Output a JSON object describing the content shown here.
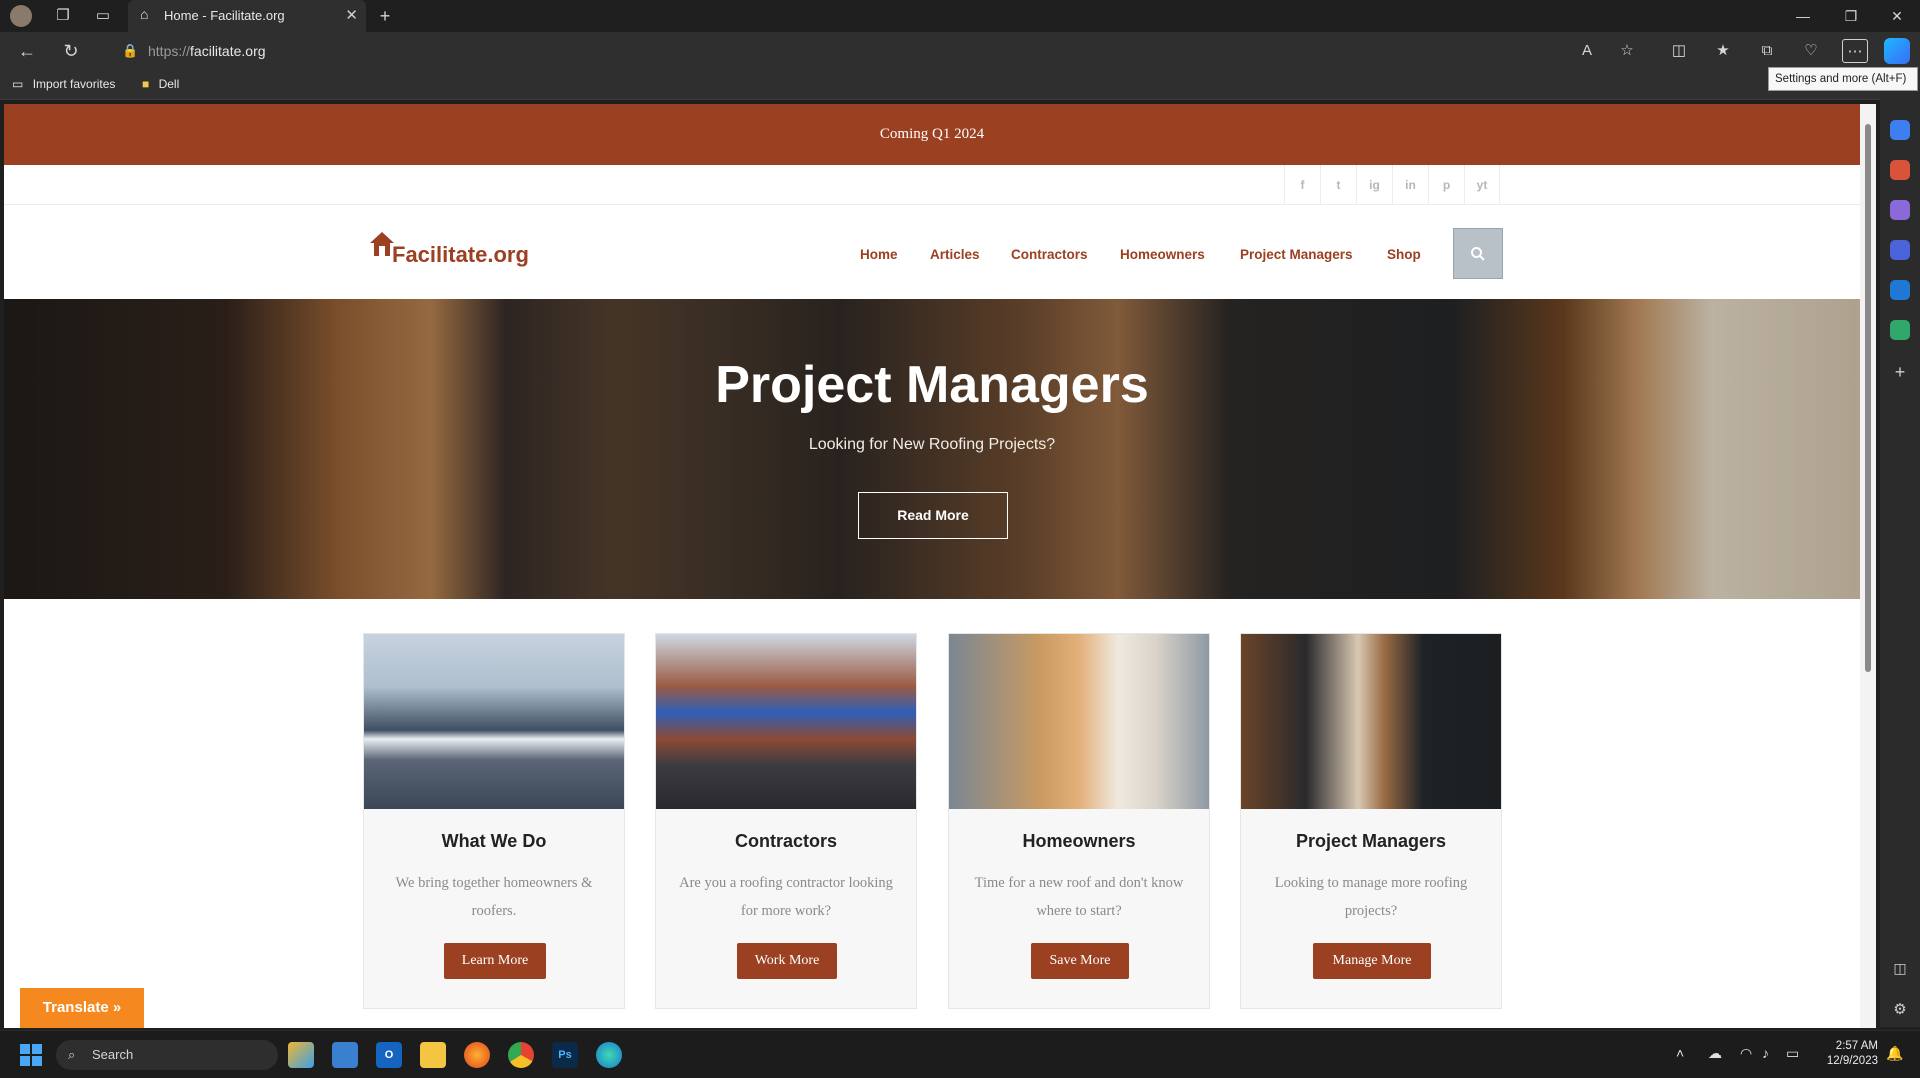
{
  "browser": {
    "tab_title": "Home - Facilitate.org",
    "url_protocol": "https://",
    "url_domain": "facilitate.org",
    "favorites": [
      {
        "label": "Import favorites"
      },
      {
        "label": "Dell"
      }
    ],
    "tooltip": "Settings and more (Alt+F)"
  },
  "site": {
    "announcement": "Coming Q1 2024",
    "social": [
      "f",
      "t",
      "ig",
      "in",
      "p",
      "yt"
    ],
    "logo_text": "Facilitate.org",
    "menu": [
      "Home",
      "Articles",
      "Contractors",
      "Homeowners",
      "Project Managers",
      "Shop"
    ],
    "hero": {
      "title": "Project Managers",
      "subtitle": "Looking for New Roofing Projects?",
      "button": "Read More"
    },
    "cards": [
      {
        "title": "What We Do",
        "desc": "We bring together homeowners & roofers.",
        "button": "Learn More"
      },
      {
        "title": "Contractors",
        "desc": "Are you a roofing contractor looking for more work?",
        "button": "Work More"
      },
      {
        "title": "Homeowners",
        "desc": "Time for a new roof and don't know where to start?",
        "button": "Save More"
      },
      {
        "title": "Project Managers",
        "desc": "Looking to manage more roofing projects?",
        "button": "Manage More"
      }
    ],
    "translate_button": "Translate »",
    "brand_color": "#9c4022"
  },
  "taskbar": {
    "search_placeholder": "Search",
    "time": "2:57 AM",
    "date": "12/9/2023"
  }
}
